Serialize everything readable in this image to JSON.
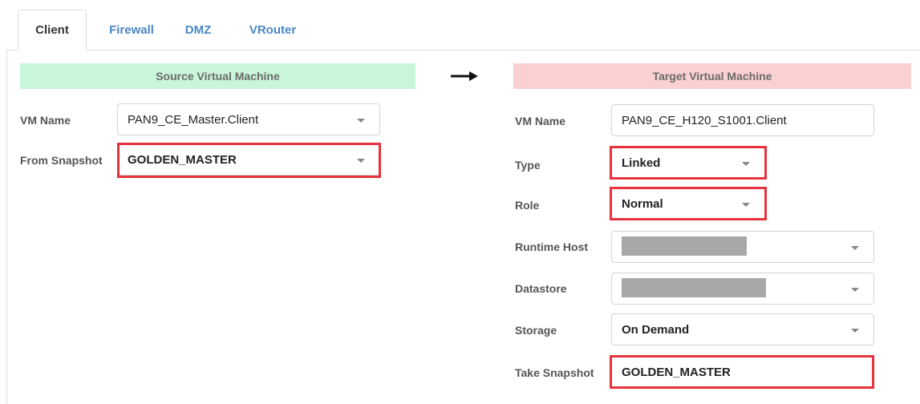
{
  "tabs": [
    {
      "label": "Client",
      "active": true
    },
    {
      "label": "Firewall",
      "active": false
    },
    {
      "label": "DMZ",
      "active": false
    },
    {
      "label": "VRouter",
      "active": false
    }
  ],
  "source": {
    "header": "Source Virtual Machine",
    "vm_name_label": "VM Name",
    "vm_name_value": "PAN9_CE_Master.Client",
    "from_snapshot_label": "From Snapshot",
    "from_snapshot_value": "GOLDEN_MASTER"
  },
  "target": {
    "header": "Target Virtual Machine",
    "vm_name_label": "VM Name",
    "vm_name_value": "PAN9_CE_H120_S1001.Client",
    "type_label": "Type",
    "type_value": "Linked",
    "role_label": "Role",
    "role_value": "Normal",
    "runtime_host_label": "Runtime Host",
    "runtime_host_value": "",
    "datastore_label": "Datastore",
    "datastore_value": "",
    "storage_label": "Storage",
    "storage_value": "On Demand",
    "take_snapshot_label": "Take Snapshot",
    "take_snapshot_value": "GOLDEN_MASTER"
  },
  "icons": {
    "arrow": "arrow-right-icon",
    "dropdown": "chevron-down-icon"
  },
  "colors": {
    "source_header_bg": "#c9f5d8",
    "target_header_bg": "#fbd0d0",
    "highlight": "#e6333d",
    "tab_link": "#4a86c5"
  }
}
